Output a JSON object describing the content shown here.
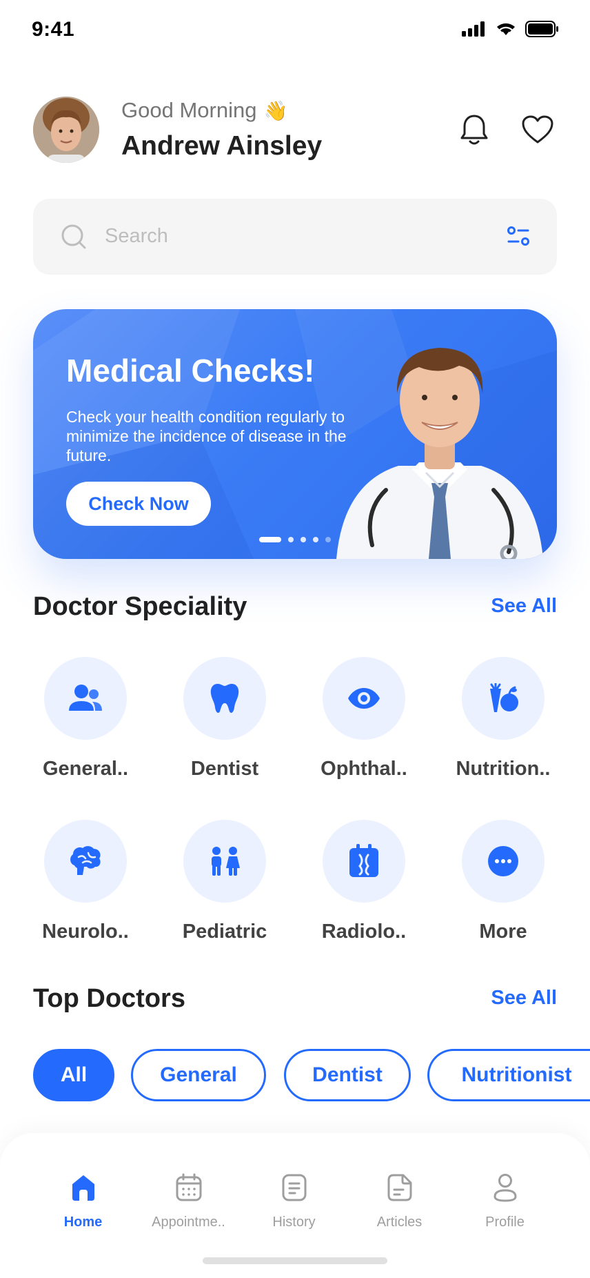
{
  "status_bar": {
    "time": "9:41"
  },
  "header": {
    "greeting": "Good Morning",
    "greeting_emoji": "👋",
    "user_name": "Andrew Ainsley"
  },
  "search": {
    "placeholder": "Search"
  },
  "banner": {
    "title": "Medical Checks!",
    "text": "Check your health condition regularly to minimize the incidence of disease in the future.",
    "button": "Check Now",
    "slides": 5,
    "active_slide": 1
  },
  "specialty": {
    "title": "Doctor Speciality",
    "see_all": "See All",
    "items": [
      {
        "label": "General..",
        "icon": "users-icon"
      },
      {
        "label": "Dentist",
        "icon": "tooth-icon"
      },
      {
        "label": "Ophthal..",
        "icon": "eye-icon"
      },
      {
        "label": "Nutrition..",
        "icon": "fruit-vegetable-icon"
      },
      {
        "label": "Neurolo..",
        "icon": "brain-icon"
      },
      {
        "label": "Pediatric",
        "icon": "children-icon"
      },
      {
        "label": "Radiolo..",
        "icon": "xray-icon"
      },
      {
        "label": "More",
        "icon": "more-icon"
      }
    ]
  },
  "top_doctors": {
    "title": "Top Doctors",
    "see_all": "See All",
    "chips": [
      "All",
      "General",
      "Dentist",
      "Nutritionist"
    ],
    "active_chip": "All"
  },
  "bottom_nav": {
    "items": [
      {
        "label": "Home",
        "icon": "home-icon",
        "active": true
      },
      {
        "label": "Appointme..",
        "icon": "calendar-icon",
        "active": false
      },
      {
        "label": "History",
        "icon": "document-icon",
        "active": false
      },
      {
        "label": "Articles",
        "icon": "article-icon",
        "active": false
      },
      {
        "label": "Profile",
        "icon": "profile-icon",
        "active": false
      }
    ]
  },
  "colors": {
    "primary": "#246bfd",
    "light_blue": "#ebf1ff",
    "text": "#212121",
    "muted": "#9e9e9e"
  }
}
